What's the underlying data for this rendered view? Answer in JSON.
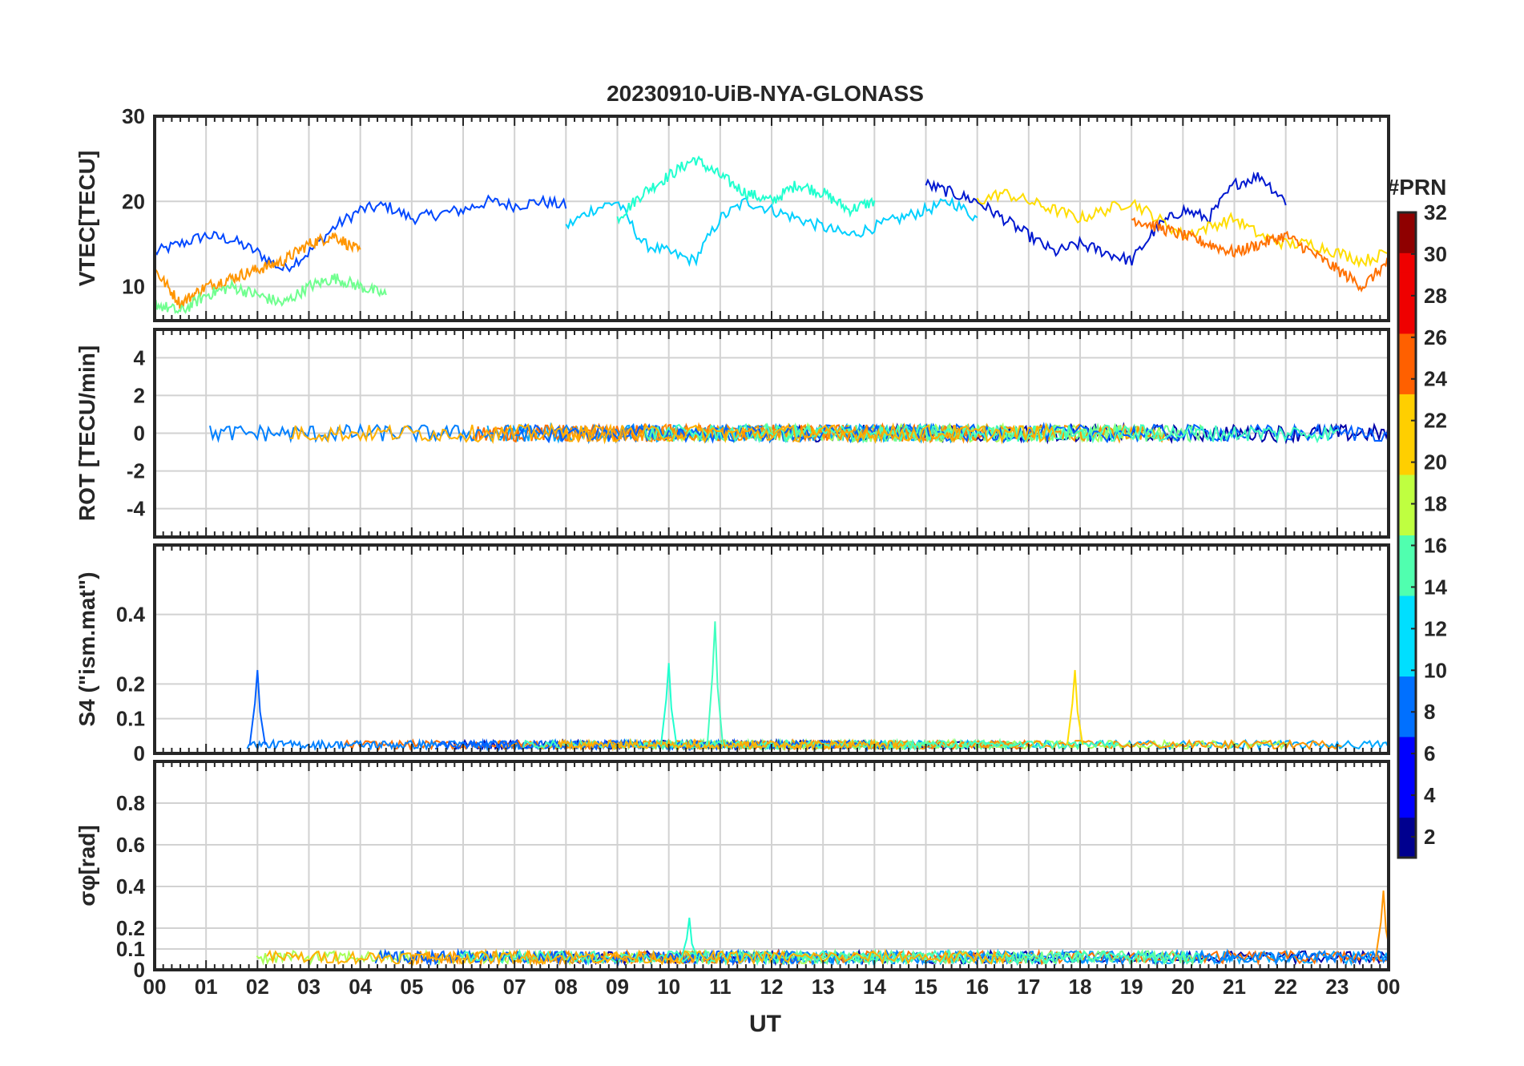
{
  "title": "20230910-UiB-NYA-GLONASS",
  "colorbar": {
    "label": "#PRN",
    "range": [
      1,
      32
    ],
    "ticks": [
      "2",
      "4",
      "6",
      "8",
      "10",
      "12",
      "14",
      "16",
      "18",
      "20",
      "22",
      "24",
      "26",
      "28",
      "30",
      "32"
    ]
  },
  "chart_data": [
    {
      "type": "line",
      "ylabel": "VTEC[TECU]",
      "ylim": [
        6,
        30
      ],
      "yticks": [
        10,
        20,
        30
      ],
      "grid": true,
      "series": [
        {
          "prn": 4,
          "color": "#0047ff",
          "x": [
            0,
            0.5,
            1,
            1.5,
            2,
            2.5,
            3,
            3.5,
            4,
            4.5,
            5,
            5.5,
            6,
            6.5,
            7,
            7.5,
            8
          ],
          "y": [
            14,
            15,
            16,
            15.5,
            14,
            12,
            14,
            17,
            19,
            19.5,
            18,
            18.5,
            19,
            20,
            19.5,
            20,
            19.5
          ]
        },
        {
          "prn": 11,
          "color": "#00d0ff",
          "x": [
            8,
            8.5,
            9,
            9.5,
            10,
            10.5,
            11,
            11.5,
            12,
            12.5,
            13,
            13.5,
            14,
            14.5,
            15,
            15.5,
            16
          ],
          "y": [
            17,
            19,
            20,
            15,
            14,
            13,
            18,
            20,
            19,
            18,
            17,
            16,
            17,
            18,
            19,
            20,
            18
          ]
        },
        {
          "prn": 14,
          "color": "#20ffcf",
          "x": [
            9,
            9.5,
            10,
            10.5,
            11,
            11.5,
            12,
            12.5,
            13,
            13.5,
            14
          ],
          "y": [
            18,
            21,
            23,
            25,
            23,
            21,
            20,
            22,
            21,
            19,
            20
          ]
        },
        {
          "prn": 2,
          "color": "#0018d0",
          "x": [
            15,
            15.5,
            16,
            16.5,
            17,
            17.5,
            18,
            18.5,
            19,
            19.5,
            20,
            20.5,
            21,
            21.5,
            22
          ],
          "y": [
            22,
            21,
            20,
            18,
            16,
            14,
            15,
            14,
            13,
            17,
            19,
            18,
            22,
            23,
            20
          ]
        },
        {
          "prn": 24,
          "color": "#ff9500",
          "x": [
            0,
            0.5,
            1,
            1.5,
            2,
            2.5,
            3,
            3.5,
            4
          ],
          "y": [
            12,
            8,
            10,
            11,
            12,
            13,
            15,
            16,
            14
          ]
        },
        {
          "prn": 16,
          "color": "#70ff8f",
          "x": [
            0,
            0.5,
            1,
            1.5,
            2,
            2.5,
            3,
            3.5,
            4,
            4.5
          ],
          "y": [
            8,
            7,
            9,
            10,
            9,
            8,
            10,
            11,
            10,
            9
          ]
        },
        {
          "prn": 20,
          "color": "#ffdd00",
          "x": [
            16,
            16.5,
            17,
            17.5,
            18,
            18.5,
            19,
            19.5,
            20,
            20.5,
            21,
            21.5,
            22,
            22.5,
            23,
            23.5,
            24
          ],
          "y": [
            20,
            21,
            20,
            19,
            18,
            19,
            20,
            18,
            16,
            17,
            18,
            16,
            15,
            15,
            14,
            13,
            14
          ]
        },
        {
          "prn": 25,
          "color": "#ff7000",
          "x": [
            19,
            19.5,
            20,
            20.5,
            21,
            21.5,
            22,
            22.5,
            23,
            23.5,
            24
          ],
          "y": [
            18,
            17,
            16,
            15,
            14,
            15,
            16,
            14,
            12,
            10,
            13
          ]
        }
      ]
    },
    {
      "type": "line",
      "ylabel": "ROT [TECU/min]",
      "ylim": [
        -5.5,
        5.5
      ],
      "yticks": [
        -4,
        -2,
        0,
        2,
        4
      ],
      "grid": true,
      "series": [
        {
          "prn": 1,
          "color": "#0000a8",
          "x": [
            0,
            24
          ],
          "y": [
            0,
            0
          ]
        },
        {
          "prn": 15,
          "color": "#40ffbf",
          "x": [
            0,
            24
          ],
          "y": [
            0,
            0
          ]
        },
        {
          "prn": 24,
          "color": "#ff9500",
          "x": [
            0,
            24
          ],
          "y": [
            0,
            0
          ]
        }
      ],
      "annotations": "noise within about ±1 TECU/min with spikes up to about 3"
    },
    {
      "type": "line",
      "ylabel": "S4 (\"ism.mat\")",
      "ylim": [
        0,
        0.6
      ],
      "yticks": [
        0,
        0.1,
        0.2,
        0.4
      ],
      "grid": true,
      "series": [
        {
          "prn": 7,
          "color": "#005fff",
          "x": [
            2.0
          ],
          "y": [
            0.24
          ]
        },
        {
          "prn": 14,
          "color": "#20ffcf",
          "x": [
            10.0
          ],
          "y": [
            0.26
          ]
        },
        {
          "prn": 15,
          "color": "#40ffbf",
          "x": [
            10.9
          ],
          "y": [
            0.38
          ]
        },
        {
          "prn": 20,
          "color": "#ffdd00",
          "x": [
            17.9
          ],
          "y": [
            0.24
          ]
        }
      ],
      "annotations": "baseline around 0.02 to 0.05"
    },
    {
      "type": "line",
      "ylabel": "σφ[rad]",
      "ylim": [
        0,
        1
      ],
      "yticks": [
        0,
        0.1,
        0.2,
        0.4,
        0.6,
        0.8
      ],
      "grid": true,
      "series": [
        {
          "prn": 24,
          "color": "#ff9500",
          "x": [
            23.9
          ],
          "y": [
            0.38
          ]
        },
        {
          "prn": 14,
          "color": "#20ffcf",
          "x": [
            10.4
          ],
          "y": [
            0.25
          ]
        }
      ],
      "annotations": "baseline around 0.05 to 0.15"
    }
  ],
  "xaxis": {
    "label": "UT",
    "ticks": [
      "00",
      "01",
      "02",
      "03",
      "04",
      "05",
      "06",
      "07",
      "08",
      "09",
      "10",
      "11",
      "12",
      "13",
      "14",
      "15",
      "16",
      "17",
      "18",
      "19",
      "20",
      "21",
      "22",
      "23",
      "00"
    ]
  }
}
